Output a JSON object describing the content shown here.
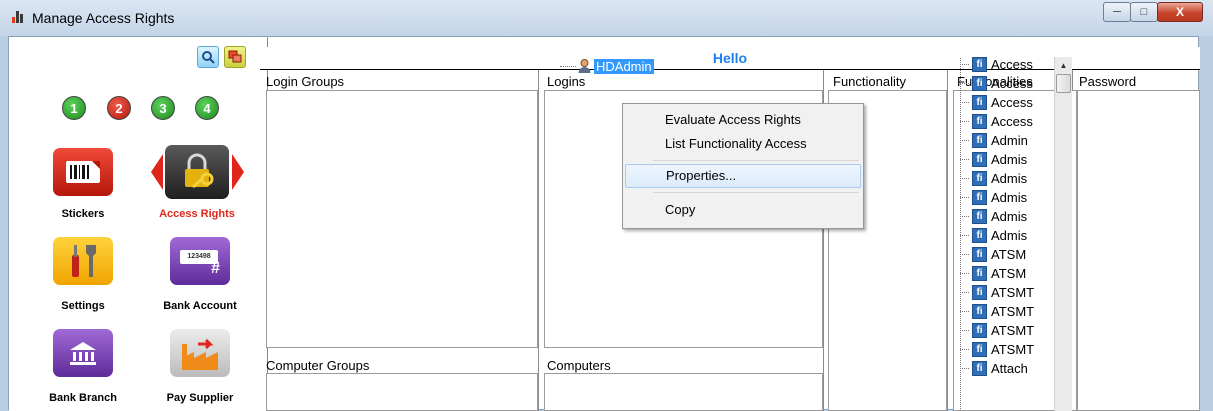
{
  "window": {
    "title": "Manage Access Rights",
    "min_glyph": "─",
    "max_glyph": "□",
    "close_glyph": "X"
  },
  "toolbar": {
    "search_icon": "search-icon",
    "windows_icon": "windows-icon"
  },
  "steps": [
    "1",
    "2",
    "3",
    "4"
  ],
  "tiles": {
    "stickers": "Stickers",
    "access_rights": "Access Rights",
    "settings": "Settings",
    "bank_account": "Bank Account",
    "bank_account_number": "123498",
    "bank_account_hash": "#",
    "bank_branch": "Bank Branch",
    "pay_supplier": "Pay Supplier"
  },
  "header": {
    "greeting": "Hello"
  },
  "columns": {
    "login_groups": "Login Groups",
    "logins": "Logins",
    "functionality": "Functionality",
    "functionalities": "Fuctionalities",
    "password": "Password",
    "computer_groups": "Computer Groups",
    "computers": "Computers"
  },
  "logins": [
    {
      "label": "HDAdmin"
    }
  ],
  "context_menu": {
    "evaluate": "Evaluate Access Rights",
    "list_functionality": "List Functionality Access",
    "properties": "Properties...",
    "copy": "Copy"
  },
  "functionalities": {
    "badge": "fi",
    "items": [
      "Access",
      "Access",
      "Access",
      "Access",
      "Admin",
      "Admis",
      "Admis",
      "Admis",
      "Admis",
      "Admis",
      "ATSM",
      "ATSM",
      "ATSMT",
      "ATSMT",
      "ATSMT",
      "ATSMT",
      "Attach"
    ]
  },
  "colors": {
    "greeting": "#1e7ff0",
    "selection": "#3399ff",
    "access_rights_label": "#e0261b",
    "fi_badge": "#2f6fb8"
  }
}
